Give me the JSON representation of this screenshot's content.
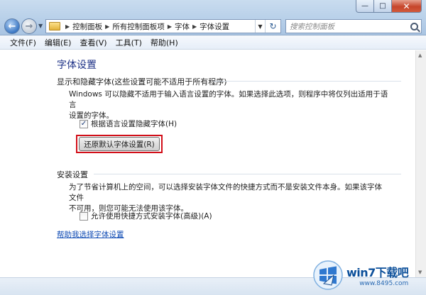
{
  "breadcrumbs": [
    "控制面板",
    "所有控制面板项",
    "字体",
    "字体设置"
  ],
  "search": {
    "placeholder": "搜索控制面板"
  },
  "menu": [
    "文件(F)",
    "编辑(E)",
    "查看(V)",
    "工具(T)",
    "帮助(H)"
  ],
  "page_title": "字体设置",
  "section_show_hide": {
    "heading": "显示和隐藏字体(这些设置可能不适用于所有程序)",
    "description_line1": "Windows 可以隐藏不适用于输入语言设置的字体。如果选择此选项，则程序中将仅列出适用于语言",
    "description_line2": "设置的字体。",
    "checkbox_label": "根据语言设置隐藏字体(H)",
    "checkbox_checked": true,
    "restore_button": "还原默认字体设置(R)"
  },
  "section_install": {
    "heading": "安装设置",
    "description_line1": "为了节省计算机上的空间，可以选择安装字体文件的快捷方式而不是安装文件本身。如果该字体文件",
    "description_line2": "不可用，则您可能无法使用该字体。",
    "checkbox_label": "允许使用快捷方式安装字体(高级)(A)",
    "checkbox_checked": false
  },
  "help_link": "帮助我选择字体设置",
  "watermark": {
    "brand": "win7下载吧",
    "url": "www.8495.com"
  },
  "colors": {
    "title": "#1e3287",
    "link": "#0f4bb4",
    "highlight": "#d20f19"
  }
}
